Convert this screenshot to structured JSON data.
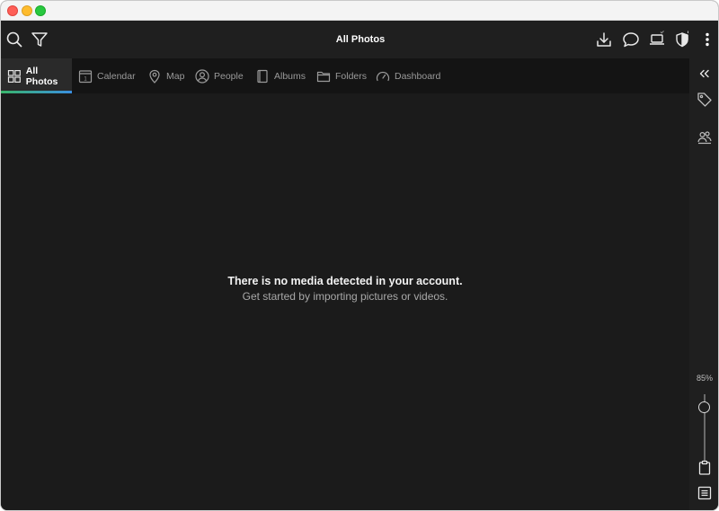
{
  "window": {
    "app_title": "All Photos"
  },
  "toolbar": {
    "left_icons": [
      "search-icon",
      "filter-icon"
    ],
    "right_icons": [
      "download-icon",
      "chat-icon",
      "laptop-status-icon",
      "shield-icon",
      "more-vertical-icon"
    ]
  },
  "tabs": [
    {
      "label": "All Photos",
      "icon": "grid-icon",
      "active": true
    },
    {
      "label": "Calendar",
      "icon": "calendar-icon",
      "active": false
    },
    {
      "label": "Map",
      "icon": "map-pin-icon",
      "active": false
    },
    {
      "label": "People",
      "icon": "person-icon",
      "active": false
    },
    {
      "label": "Albums",
      "icon": "album-icon",
      "active": false
    },
    {
      "label": "Folders",
      "icon": "folder-icon",
      "active": false
    },
    {
      "label": "Dashboard",
      "icon": "gauge-icon",
      "active": false
    }
  ],
  "empty_state": {
    "title": "There is no media detected in your account.",
    "subtitle": "Get started by importing pictures or videos."
  },
  "right_sidebar": {
    "icons": [
      "collapse-icon",
      "tag-icon",
      "people-group-icon",
      "clipboard-icon",
      "list-icon"
    ],
    "zoom_label": "85%",
    "zoom_level": 0.85
  },
  "colors": {
    "background": "#1b1b1b",
    "toolbar": "#1f1f1f",
    "tab_bar": "#141414",
    "active_tab_accent_start": "#39b56a",
    "active_tab_accent_end": "#3a8fe0"
  }
}
